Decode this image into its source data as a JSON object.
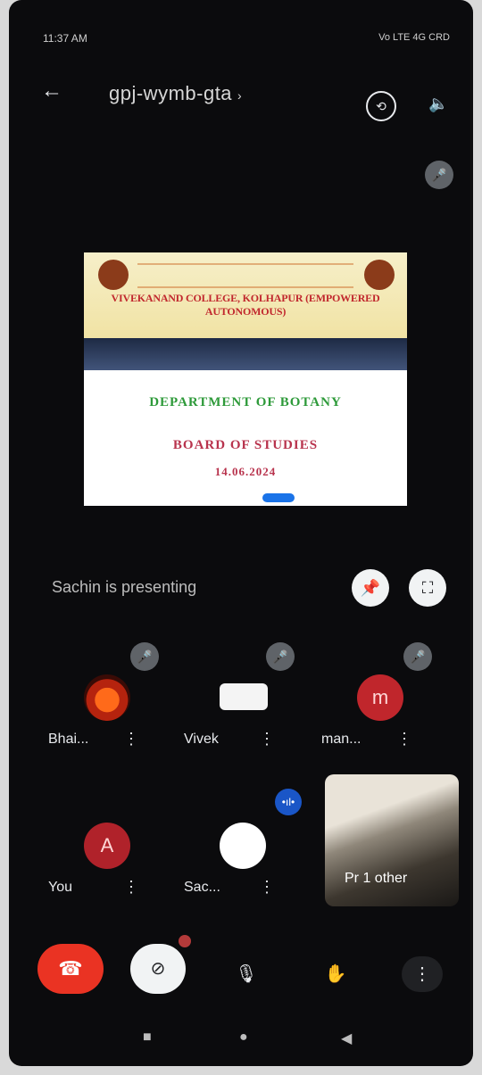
{
  "status_bar": {
    "time": "11:37 AM",
    "right": "Vo LTE 4G CRD"
  },
  "header": {
    "meeting_code": "gpj-wymb-gta",
    "chevron": "›",
    "back_icon": "←",
    "camera_icon": "⟲",
    "speaker_icon": "🔈"
  },
  "top_mute_icon": "🎤",
  "slide": {
    "college": "VIVEKANAND COLLEGE, KOLHAPUR (EMPOWERED AUTONOMOUS)",
    "department": "DEPARTMENT OF BOTANY",
    "title": "BOARD OF STUDIES",
    "date": "14.06.2024"
  },
  "presenting_text": "Sachin is presenting",
  "pin_icon": "📌",
  "fullscreen_icon": "⛶",
  "participants": [
    {
      "name": "Bhai...",
      "avatar_letter": "",
      "muted": true
    },
    {
      "name": "Vivek",
      "avatar_letter": "",
      "muted": true
    },
    {
      "name": "man...",
      "avatar_letter": "m",
      "muted": true
    },
    {
      "name": "You",
      "avatar_letter": "A",
      "muted": false
    },
    {
      "name": "Sac...",
      "avatar_letter": "",
      "muted": false,
      "speaking": true
    }
  ],
  "more_icon": "⋮",
  "video_tile_label": "Pr 1 other",
  "speaking_icon": "•ıl•",
  "controls": {
    "end_call_icon": "☎",
    "camera_off_icon": "⊘",
    "mic_icon": "🎙",
    "hand_icon": "✋",
    "more_icon": "⋮"
  },
  "nav": {
    "recent": "■",
    "home": "●",
    "back": "◀"
  }
}
